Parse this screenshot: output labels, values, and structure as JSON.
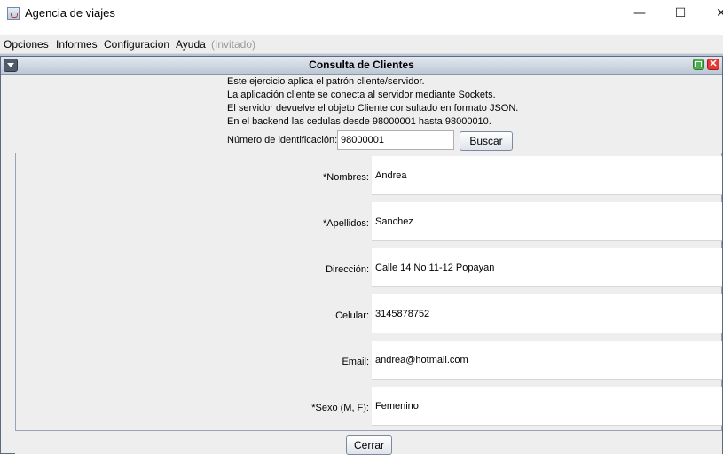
{
  "window": {
    "title": "Agencia de viajes",
    "minimize": "—",
    "maximize": "☐",
    "close": "✕"
  },
  "menu": {
    "items": [
      "Opciones",
      "Informes",
      "Configuracion",
      "Ayuda"
    ],
    "user_status": "(Invitado)"
  },
  "dialog": {
    "title": "Consulta de Clientes",
    "close": "✕",
    "info": [
      "Este ejercicio aplica el patrón cliente/servidor.",
      "La aplicación cliente se conecta al servidor mediante Sockets.",
      "El servidor devuelve el objeto Cliente consultado en formato JSON.",
      "En el backend las cedulas desde 98000001 hasta 98000010."
    ],
    "id_label": "Número de identificación:",
    "id_value": "98000001",
    "search_label": "Buscar",
    "close_label": "Cerrar",
    "fields": [
      {
        "label": "*Nombres:",
        "value": "Andrea"
      },
      {
        "label": "*Apellidos:",
        "value": "Sanchez"
      },
      {
        "label": "Dirección:",
        "value": "Calle 14 No 11-12 Popayan"
      },
      {
        "label": "Celular:",
        "value": "3145878752"
      },
      {
        "label": "Email:",
        "value": "andrea@hotmail.com"
      },
      {
        "label": "*Sexo (M, F):",
        "value": "Femenino"
      }
    ]
  },
  "colors": {
    "desktop": "#b7c4d6",
    "panel": "#eeeeee",
    "max_button": "#4caf50",
    "close_button": "#e53935"
  }
}
